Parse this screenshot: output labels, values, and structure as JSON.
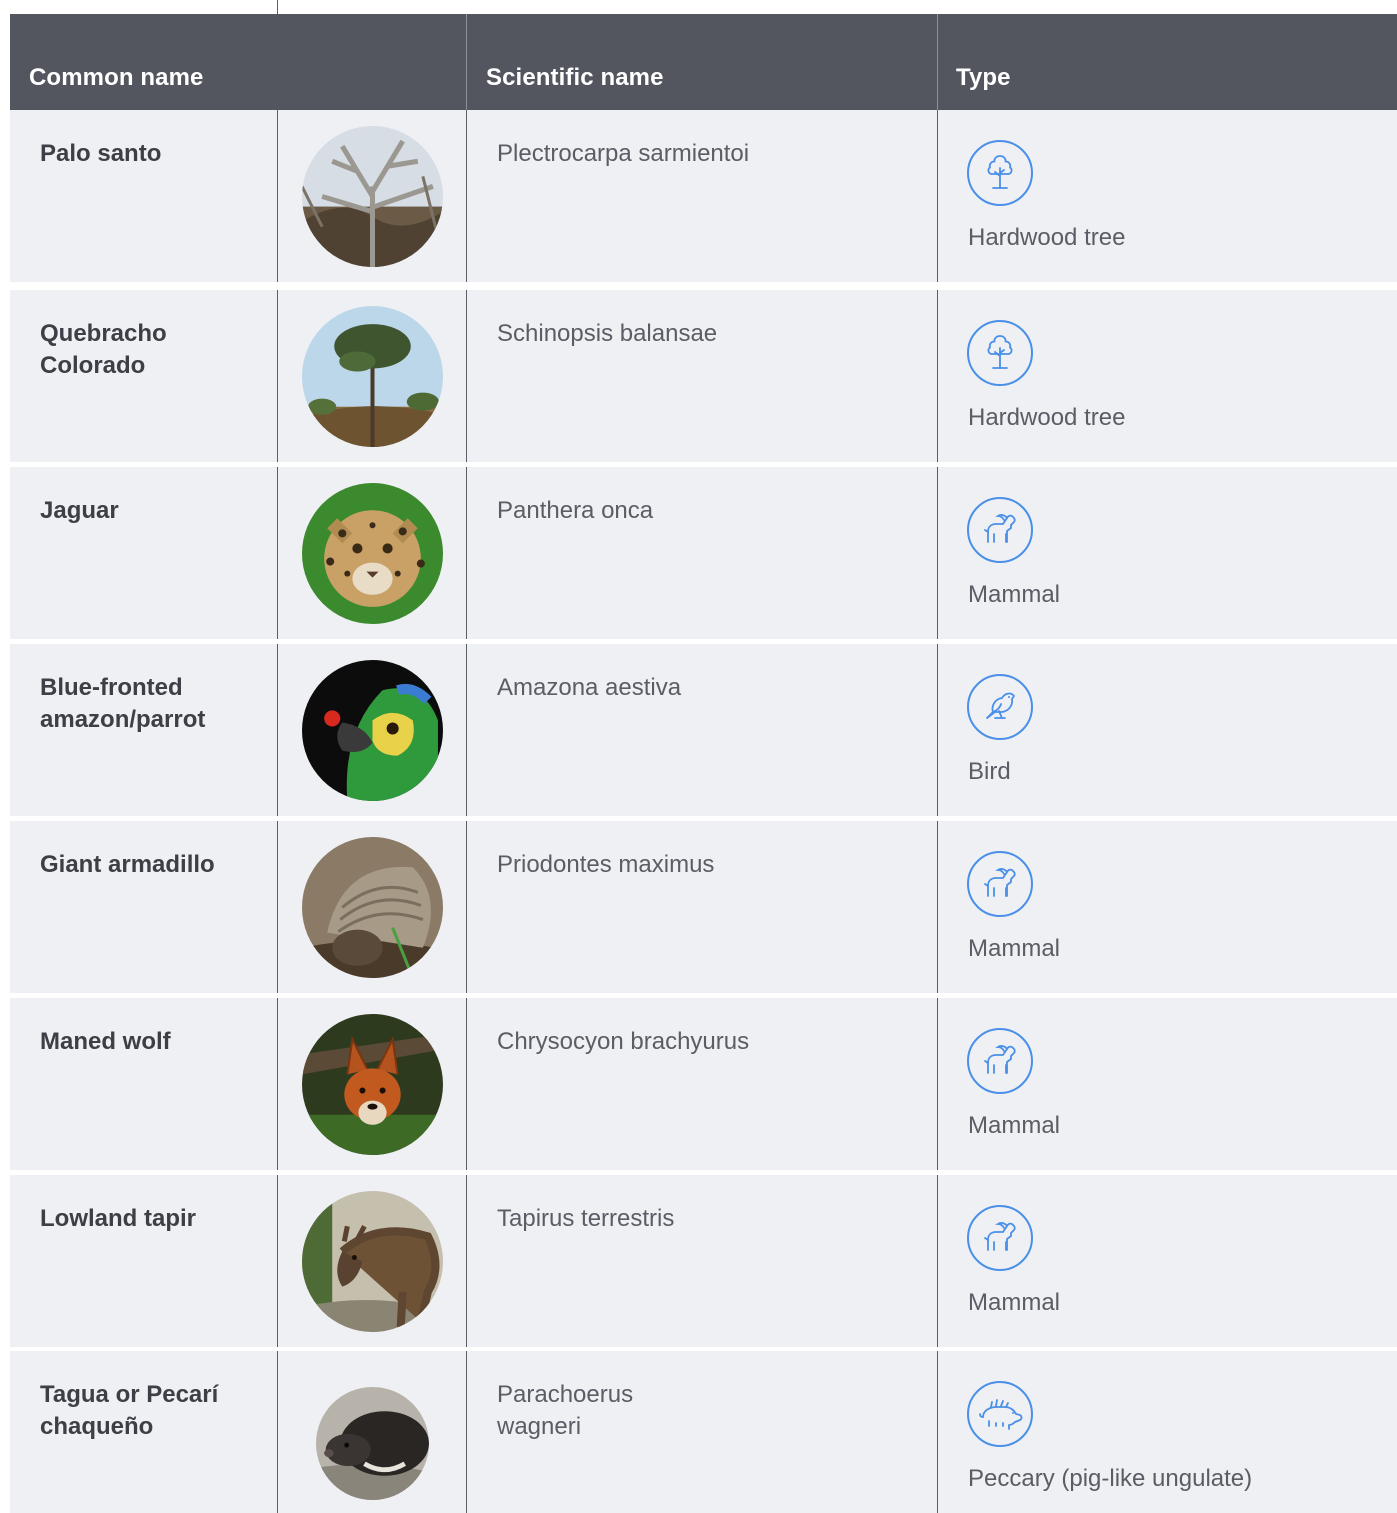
{
  "table": {
    "columns": [
      "Common name",
      "Scientific name",
      "Type"
    ],
    "rows": [
      {
        "common": "Palo santo",
        "scientific": "Plectrocarpa sarmientoi",
        "type": "Hardwood tree",
        "type_icon": "tree-icon",
        "photo": "palo-santo-photo"
      },
      {
        "common": "Quebracho Colorado",
        "scientific": "Schinopsis balansae",
        "type": "Hardwood tree",
        "type_icon": "tree-icon",
        "photo": "quebracho-photo"
      },
      {
        "common": "Jaguar",
        "scientific": "Panthera onca",
        "type": "Mammal",
        "type_icon": "mammal-icon",
        "photo": "jaguar-photo"
      },
      {
        "common": "Blue-fronted amazon/parrot",
        "scientific": "Amazona aestiva",
        "type": "Bird",
        "type_icon": "bird-icon",
        "photo": "parrot-photo"
      },
      {
        "common": "Giant armadillo",
        "scientific": "Priodontes maximus",
        "type": "Mammal",
        "type_icon": "mammal-icon",
        "photo": "armadillo-photo"
      },
      {
        "common": "Maned wolf",
        "scientific": "Chrysocyon brachyurus",
        "type": "Mammal",
        "type_icon": "mammal-icon",
        "photo": "maned-wolf-photo"
      },
      {
        "common": "Lowland tapir",
        "scientific": "Tapirus terrestris",
        "type": "Mammal",
        "type_icon": "mammal-icon",
        "photo": "tapir-photo"
      },
      {
        "common": "Tagua or Pecarí chaqueño",
        "scientific": "Parachoerus wagneri",
        "type": "Peccary (pig-like ungulate)",
        "type_icon": "peccary-icon",
        "photo": "peccary-photo"
      }
    ]
  },
  "colors": {
    "header_bg": "#53565f",
    "row_bg": "#eef0f3",
    "icon_blue": "#4a8fe8"
  }
}
